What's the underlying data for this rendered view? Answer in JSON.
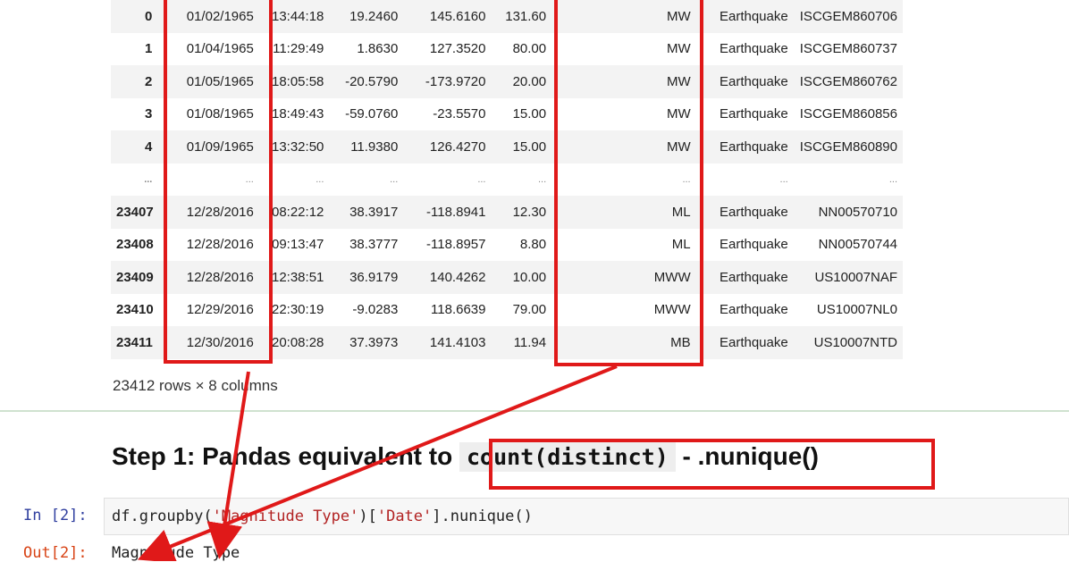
{
  "table": {
    "rows": [
      {
        "idx": "0",
        "date": "01/02/1965",
        "time": "13:44:18",
        "lat": "19.2460",
        "lon": "145.6160",
        "depth": "131.60",
        "magtype": "MW",
        "type": "Earthquake",
        "id": "ISCGEM860706"
      },
      {
        "idx": "1",
        "date": "01/04/1965",
        "time": "11:29:49",
        "lat": "1.8630",
        "lon": "127.3520",
        "depth": "80.00",
        "magtype": "MW",
        "type": "Earthquake",
        "id": "ISCGEM860737"
      },
      {
        "idx": "2",
        "date": "01/05/1965",
        "time": "18:05:58",
        "lat": "-20.5790",
        "lon": "-173.9720",
        "depth": "20.00",
        "magtype": "MW",
        "type": "Earthquake",
        "id": "ISCGEM860762"
      },
      {
        "idx": "3",
        "date": "01/08/1965",
        "time": "18:49:43",
        "lat": "-59.0760",
        "lon": "-23.5570",
        "depth": "15.00",
        "magtype": "MW",
        "type": "Earthquake",
        "id": "ISCGEM860856"
      },
      {
        "idx": "4",
        "date": "01/09/1965",
        "time": "13:32:50",
        "lat": "11.9380",
        "lon": "126.4270",
        "depth": "15.00",
        "magtype": "MW",
        "type": "Earthquake",
        "id": "ISCGEM860890"
      },
      {
        "idx": "...",
        "date": "...",
        "time": "...",
        "lat": "...",
        "lon": "...",
        "depth": "...",
        "magtype": "...",
        "type": "...",
        "id": "..."
      },
      {
        "idx": "23407",
        "date": "12/28/2016",
        "time": "08:22:12",
        "lat": "38.3917",
        "lon": "-118.8941",
        "depth": "12.30",
        "magtype": "ML",
        "type": "Earthquake",
        "id": "NN00570710"
      },
      {
        "idx": "23408",
        "date": "12/28/2016",
        "time": "09:13:47",
        "lat": "38.3777",
        "lon": "-118.8957",
        "depth": "8.80",
        "magtype": "ML",
        "type": "Earthquake",
        "id": "NN00570744"
      },
      {
        "idx": "23409",
        "date": "12/28/2016",
        "time": "12:38:51",
        "lat": "36.9179",
        "lon": "140.4262",
        "depth": "10.00",
        "magtype": "MWW",
        "type": "Earthquake",
        "id": "US10007NAF"
      },
      {
        "idx": "23410",
        "date": "12/29/2016",
        "time": "22:30:19",
        "lat": "-9.0283",
        "lon": "118.6639",
        "depth": "79.00",
        "magtype": "MWW",
        "type": "Earthquake",
        "id": "US10007NL0"
      },
      {
        "idx": "23411",
        "date": "12/30/2016",
        "time": "20:08:28",
        "lat": "37.3973",
        "lon": "141.4103",
        "depth": "11.94",
        "magtype": "MB",
        "type": "Earthquake",
        "id": "US10007NTD"
      }
    ],
    "summary": "23412 rows × 8 columns"
  },
  "heading": {
    "prefix": "Step 1: Pandas equivalent to ",
    "code": "count(distinct)",
    "suffix": " - .nunique()"
  },
  "cell_in": {
    "prompt": "In [2]:",
    "code_pre": "df.groupby(",
    "str1": "'Magnitude Type'",
    "code_mid": ")[",
    "str2": "'Date'",
    "code_post": "].nunique()"
  },
  "cell_out": {
    "prompt": "Out[2]:",
    "text": "Magnitude Type"
  },
  "annotation_color": "#e01919"
}
